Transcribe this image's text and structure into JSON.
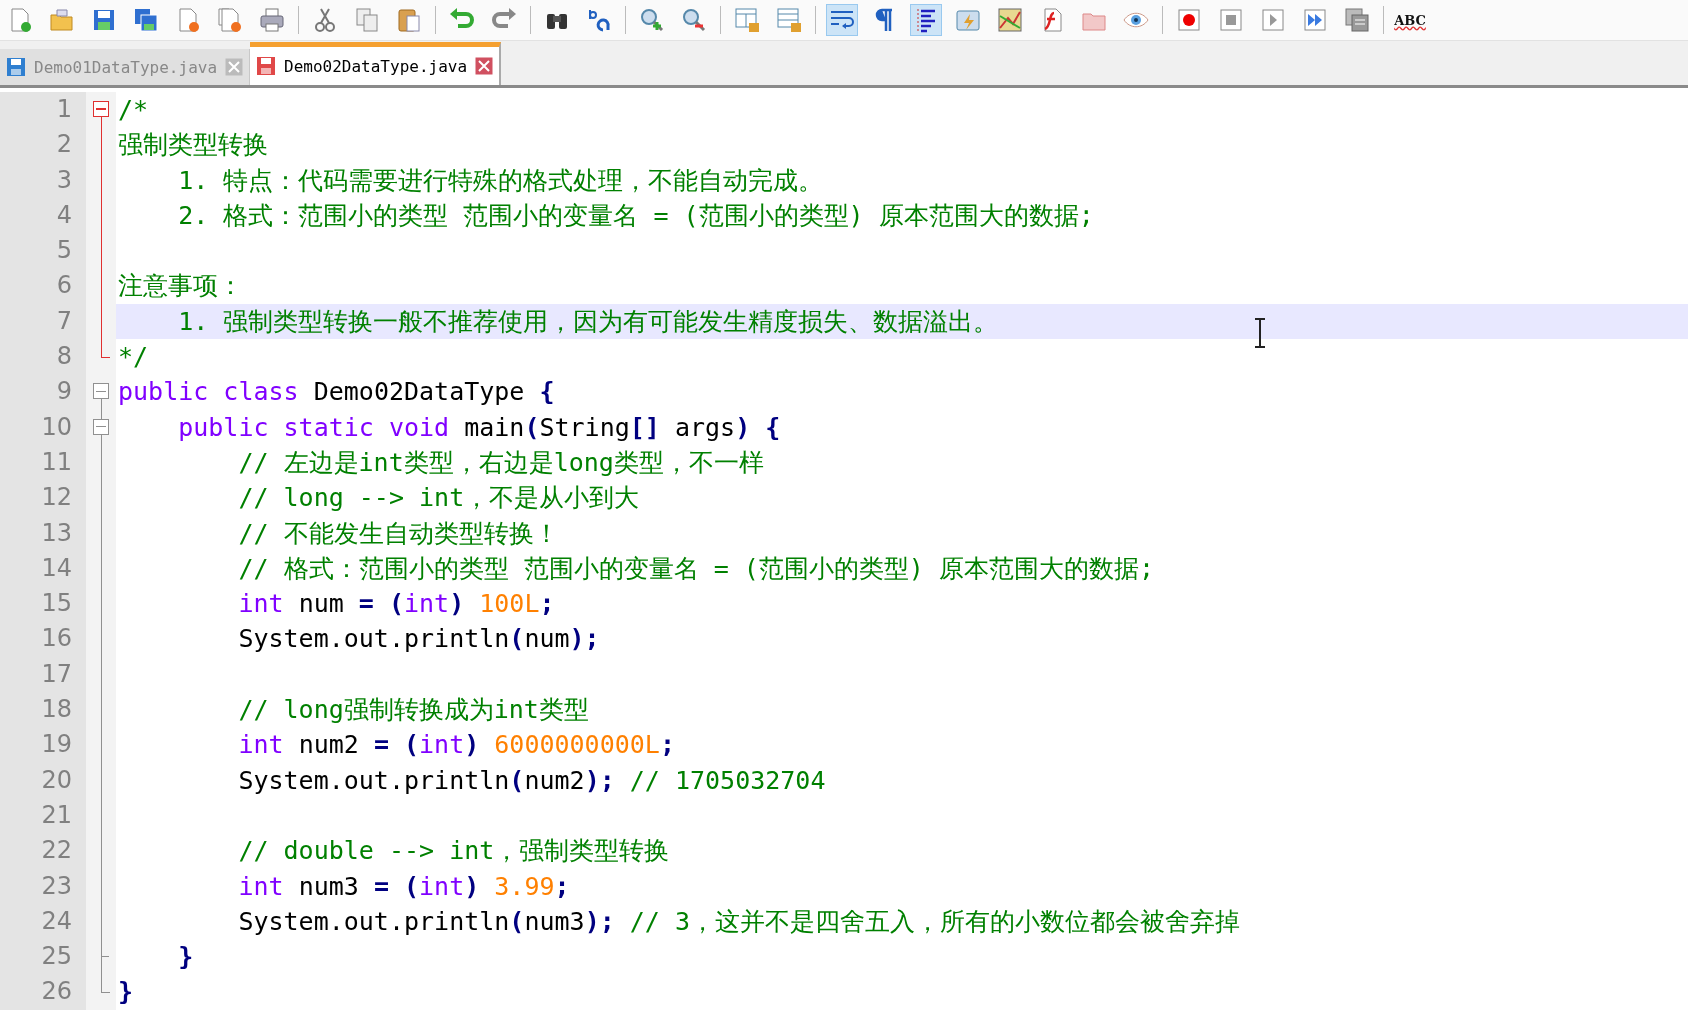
{
  "toolbar": [
    {
      "kind": "new",
      "on": false
    },
    {
      "kind": "open",
      "on": false
    },
    {
      "kind": "save",
      "on": false
    },
    {
      "kind": "save-all",
      "on": false
    },
    {
      "kind": "close",
      "on": false
    },
    {
      "kind": "close-all",
      "on": false
    },
    {
      "kind": "print",
      "on": false
    },
    {
      "kind": "separator"
    },
    {
      "kind": "cut",
      "on": false
    },
    {
      "kind": "copy",
      "on": false
    },
    {
      "kind": "paste",
      "on": false
    },
    {
      "kind": "separator"
    },
    {
      "kind": "undo",
      "on": false
    },
    {
      "kind": "redo",
      "on": false
    },
    {
      "kind": "separator"
    },
    {
      "kind": "find",
      "on": false
    },
    {
      "kind": "replace",
      "on": false
    },
    {
      "kind": "separator"
    },
    {
      "kind": "zoom-in",
      "on": false
    },
    {
      "kind": "zoom-out",
      "on": false
    },
    {
      "kind": "separator"
    },
    {
      "kind": "sync-v",
      "on": false
    },
    {
      "kind": "sync-h",
      "on": false
    },
    {
      "kind": "separator"
    },
    {
      "kind": "wrap",
      "on": true
    },
    {
      "kind": "show-all",
      "on": false
    },
    {
      "kind": "indent-guide",
      "on": true
    },
    {
      "kind": "udl",
      "on": false
    },
    {
      "kind": "doc-map",
      "on": false
    },
    {
      "kind": "function-list",
      "on": false
    },
    {
      "kind": "folder",
      "on": false
    },
    {
      "kind": "monitor",
      "on": false
    },
    {
      "kind": "separator"
    },
    {
      "kind": "record",
      "on": false
    },
    {
      "kind": "stop",
      "on": false
    },
    {
      "kind": "play",
      "on": false
    },
    {
      "kind": "play-multi",
      "on": false
    },
    {
      "kind": "save-macro",
      "on": false
    },
    {
      "kind": "separator"
    },
    {
      "kind": "spellcheck",
      "text": "ABC"
    }
  ],
  "tabs": [
    {
      "label": "Demo01DataType.java",
      "selected": false,
      "modified": false
    },
    {
      "label": "Demo02DataType.java",
      "selected": true,
      "modified": true
    }
  ],
  "editor": {
    "lines": [
      {
        "number": "1",
        "fold": {
          "kind": "start",
          "active": true
        },
        "current": false,
        "tokens": [
          {
            "kind": "comment",
            "text": "/*"
          }
        ]
      },
      {
        "number": "2",
        "fold": {
          "kind": "body",
          "active": true
        },
        "current": false,
        "tokens": [
          {
            "kind": "comment",
            "text": "强制类型转换"
          }
        ]
      },
      {
        "number": "3",
        "fold": {
          "kind": "body",
          "active": true
        },
        "current": false,
        "tokens": [
          {
            "kind": "comment",
            "text": "    1. 特点：代码需要进行特殊的格式处理，不能自动完成。"
          }
        ]
      },
      {
        "number": "4",
        "fold": {
          "kind": "body",
          "active": true
        },
        "current": false,
        "tokens": [
          {
            "kind": "comment",
            "text": "    2. 格式：范围小的类型 范围小的变量名 = (范围小的类型) 原本范围大的数据;"
          }
        ]
      },
      {
        "number": "5",
        "fold": {
          "kind": "body",
          "active": true
        },
        "current": false
      },
      {
        "number": "6",
        "fold": {
          "kind": "body",
          "active": true
        },
        "current": false,
        "tokens": [
          {
            "kind": "comment",
            "text": "注意事项："
          }
        ]
      },
      {
        "number": "7",
        "fold": {
          "kind": "body",
          "active": true
        },
        "current": true,
        "tokens": [
          {
            "kind": "comment",
            "text": "    1. 强制类型转换一般不推荐使用，因为有可能发生精度损失、数据溢出。"
          }
        ]
      },
      {
        "number": "8",
        "fold": {
          "kind": "end",
          "active": true
        },
        "current": false,
        "tokens": [
          {
            "kind": "comment",
            "text": "*/"
          }
        ]
      },
      {
        "number": "9",
        "fold": {
          "kind": "start",
          "active": false
        },
        "current": false,
        "tokens": [
          {
            "kind": "keyword",
            "text": "public class"
          },
          {
            "kind": "plain",
            "text": " Demo02DataType"
          },
          {
            "kind": "operator",
            "text": " {"
          }
        ]
      },
      {
        "number": "10",
        "fold": {
          "kind": "start",
          "active": false
        },
        "current": false,
        "tokens": [
          {
            "kind": "keyword",
            "text": "    public static void"
          },
          {
            "kind": "plain",
            "text": " main"
          },
          {
            "kind": "operator",
            "text": "("
          },
          {
            "kind": "plain",
            "text": "String"
          },
          {
            "kind": "operator",
            "text": "[]"
          },
          {
            "kind": "plain",
            "text": " args"
          },
          {
            "kind": "operator",
            "text": ") {"
          }
        ]
      },
      {
        "number": "11",
        "fold": {
          "kind": "body",
          "active": false
        },
        "current": false,
        "tokens": [
          {
            "kind": "comment",
            "text": "        // 左边是int类型，右边是long类型，不一样"
          }
        ]
      },
      {
        "number": "12",
        "fold": {
          "kind": "body",
          "active": false
        },
        "current": false,
        "tokens": [
          {
            "kind": "comment",
            "text": "        // long --> int，不是从小到大"
          }
        ]
      },
      {
        "number": "13",
        "fold": {
          "kind": "body",
          "active": false
        },
        "current": false,
        "tokens": [
          {
            "kind": "comment",
            "text": "        // 不能发生自动类型转换！"
          }
        ]
      },
      {
        "number": "14",
        "fold": {
          "kind": "body",
          "active": false
        },
        "current": false,
        "tokens": [
          {
            "kind": "comment",
            "text": "        // 格式：范围小的类型 范围小的变量名 = (范围小的类型) 原本范围大的数据;"
          }
        ]
      },
      {
        "number": "15",
        "fold": {
          "kind": "body",
          "active": false
        },
        "current": false,
        "tokens": [
          {
            "kind": "keyword",
            "text": "        int"
          },
          {
            "kind": "plain",
            "text": " num "
          },
          {
            "kind": "operator",
            "text": "= ("
          },
          {
            "kind": "keyword",
            "text": "int"
          },
          {
            "kind": "operator",
            "text": ")"
          },
          {
            "kind": "number",
            "text": " 100L"
          },
          {
            "kind": "operator",
            "text": ";"
          }
        ]
      },
      {
        "number": "16",
        "fold": {
          "kind": "body",
          "active": false
        },
        "current": false,
        "tokens": [
          {
            "kind": "plain",
            "text": "        System.out.println"
          },
          {
            "kind": "operator",
            "text": "("
          },
          {
            "kind": "plain",
            "text": "num"
          },
          {
            "kind": "operator",
            "text": ");"
          }
        ]
      },
      {
        "number": "17",
        "fold": {
          "kind": "body",
          "active": false
        },
        "current": false
      },
      {
        "number": "18",
        "fold": {
          "kind": "body",
          "active": false
        },
        "current": false,
        "tokens": [
          {
            "kind": "comment",
            "text": "        // long强制转换成为int类型"
          }
        ]
      },
      {
        "number": "19",
        "fold": {
          "kind": "body",
          "active": false
        },
        "current": false,
        "tokens": [
          {
            "kind": "keyword",
            "text": "        int"
          },
          {
            "kind": "plain",
            "text": " num2 "
          },
          {
            "kind": "operator",
            "text": "= ("
          },
          {
            "kind": "keyword",
            "text": "int"
          },
          {
            "kind": "operator",
            "text": ")"
          },
          {
            "kind": "number",
            "text": " 6000000000L"
          },
          {
            "kind": "operator",
            "text": ";"
          }
        ]
      },
      {
        "number": "20",
        "fold": {
          "kind": "body",
          "active": false
        },
        "current": false,
        "tokens": [
          {
            "kind": "plain",
            "text": "        System.out.println"
          },
          {
            "kind": "operator",
            "text": "("
          },
          {
            "kind": "plain",
            "text": "num2"
          },
          {
            "kind": "operator",
            "text": ");"
          },
          {
            "kind": "comment",
            "text": " // 1705032704"
          }
        ]
      },
      {
        "number": "21",
        "fold": {
          "kind": "body",
          "active": false
        },
        "current": false
      },
      {
        "number": "22",
        "fold": {
          "kind": "body",
          "active": false
        },
        "current": false,
        "tokens": [
          {
            "kind": "comment",
            "text": "        // double --> int，强制类型转换"
          }
        ]
      },
      {
        "number": "23",
        "fold": {
          "kind": "body",
          "active": false
        },
        "current": false,
        "tokens": [
          {
            "kind": "keyword",
            "text": "        int"
          },
          {
            "kind": "plain",
            "text": " num3 "
          },
          {
            "kind": "operator",
            "text": "= ("
          },
          {
            "kind": "keyword",
            "text": "int"
          },
          {
            "kind": "operator",
            "text": ")"
          },
          {
            "kind": "number",
            "text": " 3.99"
          },
          {
            "kind": "operator",
            "text": ";"
          }
        ]
      },
      {
        "number": "24",
        "fold": {
          "kind": "body",
          "active": false
        },
        "current": false,
        "tokens": [
          {
            "kind": "plain",
            "text": "        System.out.println"
          },
          {
            "kind": "operator",
            "text": "("
          },
          {
            "kind": "plain",
            "text": "num3"
          },
          {
            "kind": "operator",
            "text": ");"
          },
          {
            "kind": "comment",
            "text": " // 3，这并不是四舍五入，所有的小数位都会被舍弃掉"
          }
        ]
      },
      {
        "number": "25",
        "fold": {
          "kind": "inner-end",
          "active": false
        },
        "current": false,
        "tokens": [
          {
            "kind": "operator",
            "text": "    }"
          }
        ]
      },
      {
        "number": "26",
        "fold": {
          "kind": "end",
          "active": false
        },
        "current": false,
        "tokens": [
          {
            "kind": "operator",
            "text": "}"
          }
        ]
      }
    ]
  }
}
